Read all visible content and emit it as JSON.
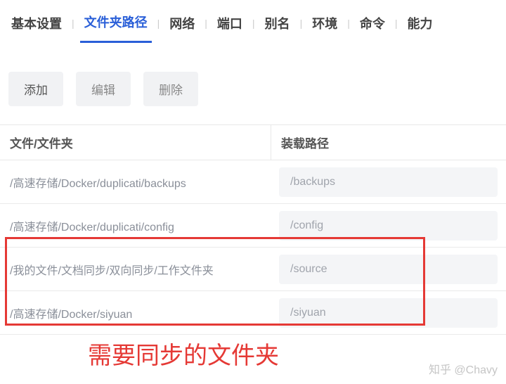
{
  "tabs": {
    "items": [
      {
        "label": "基本设置"
      },
      {
        "label": "文件夹路径"
      },
      {
        "label": "网络"
      },
      {
        "label": "端口"
      },
      {
        "label": "别名"
      },
      {
        "label": "环境"
      },
      {
        "label": "命令"
      },
      {
        "label": "能力"
      }
    ],
    "activeIndex": 1
  },
  "toolbar": {
    "add": "添加",
    "edit": "编辑",
    "delete": "删除"
  },
  "tableHeader": {
    "fileFolder": "文件/文件夹",
    "mountPath": "装载路径"
  },
  "rows": [
    {
      "path": "/高速存储/Docker/duplicati/backups",
      "mount": "/backups"
    },
    {
      "path": "/高速存储/Docker/duplicati/config",
      "mount": "/config"
    },
    {
      "path": "/我的文件/文档同步/双向同步/工作文件夹",
      "mount": "/source"
    },
    {
      "path": "/高速存储/Docker/siyuan",
      "mount": "/siyuan"
    }
  ],
  "annotation": "需要同步的文件夹",
  "watermark": "知乎 @Chavy"
}
